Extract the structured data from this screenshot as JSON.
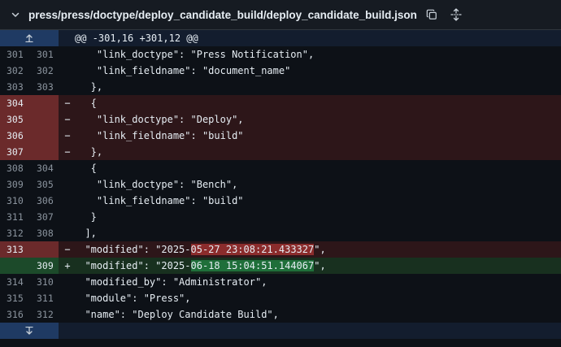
{
  "header": {
    "file_path": "press/press/doctype/deploy_candidate_build/deploy_candidate_build.json",
    "icons": [
      "chevron-down-icon",
      "copy-icon",
      "unfold-icon"
    ]
  },
  "hunk_top": {
    "text": "@@ -301,16 +301,12 @@"
  },
  "lines": [
    {
      "old": "301",
      "new": "301",
      "marker": "",
      "type": "ctx",
      "code": "    \"link_doctype\": \"Press Notification\","
    },
    {
      "old": "302",
      "new": "302",
      "marker": "",
      "type": "ctx",
      "code": "    \"link_fieldname\": \"document_name\""
    },
    {
      "old": "303",
      "new": "303",
      "marker": "",
      "type": "ctx",
      "code": "   },"
    },
    {
      "old": "304",
      "new": "",
      "marker": "−",
      "type": "del",
      "code": "   {"
    },
    {
      "old": "305",
      "new": "",
      "marker": "−",
      "type": "del",
      "code": "    \"link_doctype\": \"Deploy\","
    },
    {
      "old": "306",
      "new": "",
      "marker": "−",
      "type": "del",
      "code": "    \"link_fieldname\": \"build\""
    },
    {
      "old": "307",
      "new": "",
      "marker": "−",
      "type": "del",
      "code": "   },"
    },
    {
      "old": "308",
      "new": "304",
      "marker": "",
      "type": "ctx",
      "code": "   {"
    },
    {
      "old": "309",
      "new": "305",
      "marker": "",
      "type": "ctx",
      "code": "    \"link_doctype\": \"Bench\","
    },
    {
      "old": "310",
      "new": "306",
      "marker": "",
      "type": "ctx",
      "code": "    \"link_fieldname\": \"build\""
    },
    {
      "old": "311",
      "new": "307",
      "marker": "",
      "type": "ctx",
      "code": "   }"
    },
    {
      "old": "312",
      "new": "308",
      "marker": "",
      "type": "ctx",
      "code": "  ],"
    },
    {
      "old": "313",
      "new": "",
      "marker": "−",
      "type": "del",
      "code_pre": "  \"modified\": \"2025-",
      "code_hl": "05-27 23:08:21.433327",
      "code_post": "\","
    },
    {
      "old": "",
      "new": "309",
      "marker": "+",
      "type": "add",
      "code_pre": "  \"modified\": \"2025-",
      "code_hl": "06-18 15:04:51.144067",
      "code_post": "\","
    },
    {
      "old": "314",
      "new": "310",
      "marker": "",
      "type": "ctx",
      "code": "  \"modified_by\": \"Administrator\","
    },
    {
      "old": "315",
      "new": "311",
      "marker": "",
      "type": "ctx",
      "code": "  \"module\": \"Press\","
    },
    {
      "old": "316",
      "new": "312",
      "marker": "",
      "type": "ctx",
      "code": "  \"name\": \"Deploy Candidate Build\","
    }
  ],
  "colors": {
    "background": "#0d1117",
    "deletion_line": "#2d1619",
    "addition_line": "#18301f",
    "hunk_header": "#131d2e"
  }
}
